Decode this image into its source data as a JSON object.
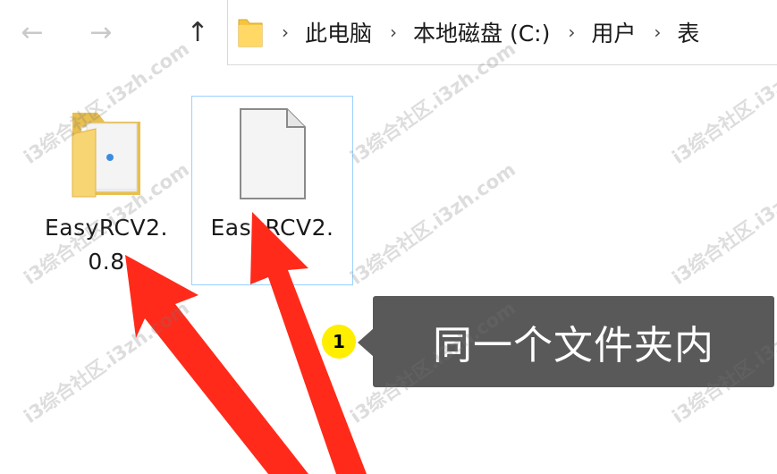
{
  "navigation": {
    "back_icon": "back-arrow-icon",
    "forward_icon": "forward-arrow-icon",
    "up_icon": "up-arrow-icon"
  },
  "address_bar": {
    "folder_icon": "folder-icon",
    "crumbs": [
      "此电脑",
      "本地磁盘 (C:)",
      "用户",
      "表"
    ]
  },
  "files": [
    {
      "name_line1": "EasyRCV2.",
      "name_line2": "0.8",
      "type": "folder"
    },
    {
      "name_line1": "EasyRCV2.",
      "name_line2": "",
      "type": "file",
      "selected": true
    }
  ],
  "annotation": {
    "step_number": "1",
    "text": "同一个文件夹内",
    "badge_color": "#ffee00",
    "arrow_color": "#ff2a1a"
  },
  "watermark": {
    "text": "i3综合社区.i3zh.com"
  }
}
